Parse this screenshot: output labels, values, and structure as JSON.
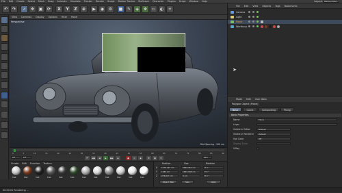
{
  "menubar": {
    "items": [
      "File",
      "Edit",
      "Create",
      "Select",
      "Mesh",
      "Snap",
      "Animate",
      "Simulate",
      "Tracker",
      "Render",
      "Sculpt",
      "Motion Tracker",
      "MoGraph",
      "Character",
      "Plugins",
      "Script",
      "Window",
      "Help"
    ],
    "layout_label": "Layout:",
    "layout_value": "Startup (User)"
  },
  "toolbar": {
    "buttons": [
      "undo",
      "redo",
      "live-selection",
      "move",
      "scale",
      "rotate",
      "x",
      "y",
      "z",
      "world",
      "render-view",
      "render",
      "render-settings",
      "cube",
      "pen",
      "subdivide",
      "array",
      "floor",
      "camera",
      "light"
    ],
    "axis_labels": [
      "X",
      "Y",
      "Z"
    ]
  },
  "viewport": {
    "menu": [
      "View",
      "Cameras",
      "Display",
      "Options",
      "Filter",
      "Panel"
    ],
    "label": "Perspective",
    "grid_spacing": "Grid Spacing : 100 cm"
  },
  "timeline": {
    "ticks": [
      "0",
      "5",
      "10",
      "15",
      "20",
      "25",
      "30",
      "35",
      "40",
      "45",
      "50",
      "55",
      "60",
      "65",
      "70",
      "75",
      "80",
      "85",
      "90"
    ],
    "frame_start": "0 F",
    "frame_end": "90 F",
    "current": "0 F"
  },
  "materials": {
    "menu": [
      "Create",
      "Edit",
      "Function",
      "Texture"
    ],
    "items": [
      {
        "name": "Mat",
        "color": "#c9c9c9"
      },
      {
        "name": "Mat",
        "color": "#7a3a1e"
      },
      {
        "name": "Mat",
        "color": "#1f1f1f"
      },
      {
        "name": "Mat",
        "color": "#5a5a5a"
      },
      {
        "name": "Mat",
        "color": "#3a3a3a"
      },
      {
        "name": "Mat",
        "color": "#2f4a2a"
      },
      {
        "name": "Mat",
        "color": "#b0b0b0"
      },
      {
        "name": "Mat",
        "color": "#d8d8d8"
      },
      {
        "name": "Mat",
        "color": "#8e8e8e"
      },
      {
        "name": "Mat",
        "color": "#cfcfcf"
      },
      {
        "name": "Mat",
        "color": "#e8e8e8"
      },
      {
        "name": "Mat",
        "color": "#ffffff"
      }
    ]
  },
  "coordinates": {
    "headers": [
      "Position",
      "Size",
      "Rotation"
    ],
    "rows": [
      {
        "axis": "X",
        "pos": "-1470.167 cm",
        "size": "2949.361 cm",
        "rot": "H 0 °"
      },
      {
        "axis": "Y",
        "pos": "1.284 cm",
        "size": "1659.308 cm",
        "rot": "P 0 °"
      },
      {
        "axis": "Z",
        "pos": "-276.617 cm",
        "size": "0 cm",
        "rot": "B 0 °"
      }
    ],
    "mode": "Object (Rel)",
    "size_mode": "Size",
    "apply_label": "Apply"
  },
  "status": {
    "text": "00:00:01 Rendering ..."
  },
  "object_manager": {
    "menu": [
      "File",
      "Edit",
      "View",
      "Objects",
      "Tags",
      "Bookmarks"
    ],
    "objects": [
      {
        "name": "Camera",
        "icon_color": "#6a9ad8"
      },
      {
        "name": "Light",
        "icon_color": "#e0d070"
      },
      {
        "name": "Plane",
        "icon_color": "#7fbf6a"
      },
      {
        "name": "Wartburg",
        "icon_color": "#5aa8c8"
      }
    ]
  },
  "attribute_manager": {
    "menu": [
      "Mode",
      "Edit",
      "User Data"
    ],
    "title": "Polygon Object [Plane]",
    "tabs": [
      "Basic",
      "Coord.",
      "Compositing",
      "Phong"
    ],
    "section": "Basic Properties",
    "rows": [
      {
        "label": "Name",
        "value": "Plane"
      },
      {
        "label": "Layer",
        "value": ""
      },
      {
        "label": "Visible in Editor",
        "value": "Default"
      },
      {
        "label": "Visible in Renderer",
        "value": "Default"
      },
      {
        "label": "Use Color",
        "value": "Off"
      },
      {
        "label": "Display Color",
        "value": ""
      },
      {
        "label": "X-Ray",
        "value": ""
      }
    ]
  },
  "colors": {
    "accent": "#5e6d82",
    "background": "#2b2b2b",
    "render_region_bg": "#000000"
  }
}
